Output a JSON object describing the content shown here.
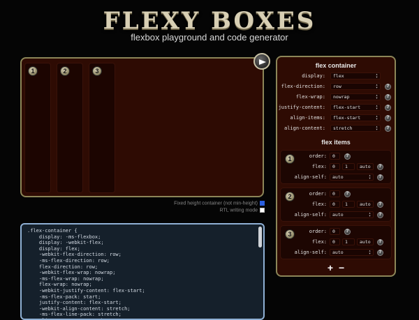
{
  "header": {
    "logo": "FLEXY BOXES",
    "tagline": "flexbox playground and code generator"
  },
  "playground": {
    "items": [
      {
        "number": "1"
      },
      {
        "number": "2"
      },
      {
        "number": "3"
      }
    ],
    "fixed_height_label": "Fixed height container (not min-height)",
    "fixed_height_checked": true,
    "rtl_label": "RTL writing mode",
    "rtl_checked": false
  },
  "code": {
    "text": ".flex-container {\n    display: -ms-flexbox;\n    display: -webkit-flex;\n    display: flex;\n    -webkit-flex-direction: row;\n    -ms-flex-direction: row;\n    flex-direction: row;\n    -webkit-flex-wrap: nowrap;\n    -ms-flex-wrap: nowrap;\n    flex-wrap: nowrap;\n    -webkit-justify-content: flex-start;\n    -ms-flex-pack: start;\n    justify-content: flex-start;\n    -webkit-align-content: stretch;\n    -ms-flex-line-pack: stretch;\n    align-content: stretch;"
  },
  "panel": {
    "container_title": "flex container",
    "container_props": [
      {
        "label": "display:",
        "value": "flex",
        "help": false
      },
      {
        "label": "flex-direction:",
        "value": "row",
        "help": true
      },
      {
        "label": "flex-wrap:",
        "value": "nowrap",
        "help": true
      },
      {
        "label": "justify-content:",
        "value": "flex-start",
        "help": true
      },
      {
        "label": "align-items:",
        "value": "flex-start",
        "help": true
      },
      {
        "label": "align-content:",
        "value": "stretch",
        "help": true
      }
    ],
    "items_title": "flex items",
    "labels": {
      "order": "order:",
      "flex": "flex:",
      "align_self": "align-self:"
    },
    "help_glyph": "?",
    "items": [
      {
        "number": "1",
        "order": "0",
        "grow": "0",
        "shrink": "1",
        "basis": "auto",
        "align_self": "auto"
      },
      {
        "number": "2",
        "order": "0",
        "grow": "0",
        "shrink": "1",
        "basis": "auto",
        "align_self": "auto"
      },
      {
        "number": "3",
        "order": "0",
        "grow": "0",
        "shrink": "1",
        "basis": "auto",
        "align_self": "auto"
      }
    ],
    "add_label": "+",
    "remove_label": "−"
  }
}
